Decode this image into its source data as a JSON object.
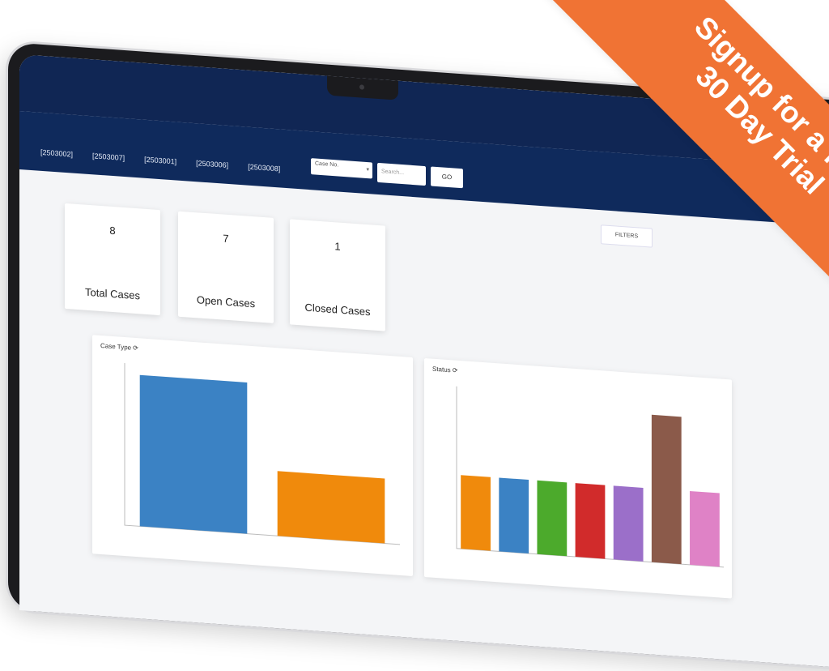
{
  "header": {
    "case_tabs": [
      "[2503002]",
      "[2503007]",
      "[2503001]",
      "[2503006]",
      "[2503008]"
    ],
    "search": {
      "filter_select_value": "Case No.",
      "search_placeholder": "Search...",
      "go_label": "GO"
    },
    "filters_label": "FILTERS"
  },
  "stats": [
    {
      "value": "8",
      "label": "Total Cases"
    },
    {
      "value": "7",
      "label": "Open Cases"
    },
    {
      "value": "1",
      "label": "Closed Cases"
    }
  ],
  "panels": {
    "case_type": {
      "title": "Case Type",
      "refresh_icon": "refresh-icon"
    },
    "status": {
      "title": "Status",
      "refresh_icon": "refresh-icon"
    }
  },
  "chart_data": [
    {
      "type": "bar",
      "title": "Case Type",
      "categories": [
        "",
        ""
      ],
      "values": [
        7,
        3
      ],
      "colors": [
        "#3b82c4",
        "#f08a0c"
      ],
      "ylim": [
        0,
        7.5
      ],
      "grid": false
    },
    {
      "type": "bar",
      "title": "Status",
      "categories": [
        "",
        "",
        "",
        "",
        "",
        "",
        ""
      ],
      "values": [
        1,
        1,
        1,
        1,
        1,
        2,
        1
      ],
      "colors": [
        "#f08a0c",
        "#3b82c4",
        "#4caa2c",
        "#d12b2b",
        "#9b6fc9",
        "#8b5a4a",
        "#df82c6"
      ],
      "ylim": [
        0,
        2.2
      ],
      "grid": false
    }
  ],
  "promo": {
    "line1": "Signup for a free",
    "line2": "30 Day Trial",
    "color": "#f07334"
  },
  "colors": {
    "navbar": "#0f2a5c",
    "accent": "#f07334"
  }
}
